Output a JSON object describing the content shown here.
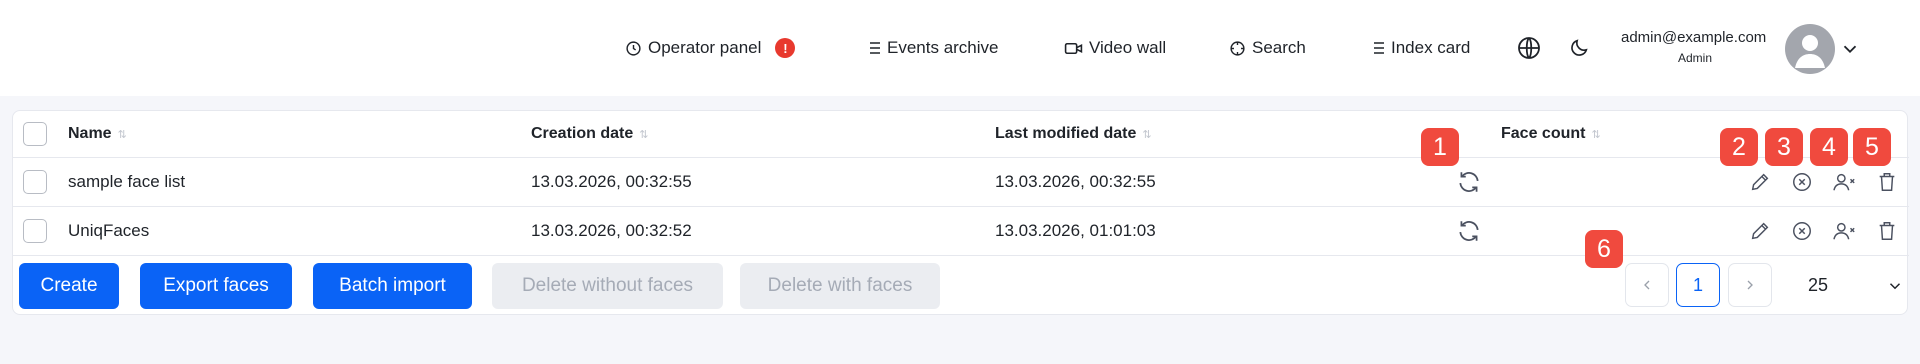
{
  "header": {
    "nav": [
      {
        "label": "Operator panel",
        "icon": "clock-icon",
        "alert": "!"
      },
      {
        "label": "Events archive",
        "icon": "list-icon"
      },
      {
        "label": "Video wall",
        "icon": "video-camera-icon"
      },
      {
        "label": "Search",
        "icon": "crosshair-icon"
      },
      {
        "label": "Index card",
        "icon": "list-icon"
      }
    ],
    "user": {
      "email": "admin@example.com",
      "role": "Admin"
    }
  },
  "table": {
    "columns": [
      "Name",
      "Creation date",
      "Last modified date",
      "Face count"
    ],
    "rows": [
      {
        "name": "sample face list",
        "created": "13.03.2026, 00:32:55",
        "modified": "13.03.2026, 00:32:55",
        "face_count": ""
      },
      {
        "name": "UniqFaces",
        "created": "13.03.2026, 00:32:52",
        "modified": "13.03.2026, 01:01:03",
        "face_count": ""
      }
    ]
  },
  "footer": {
    "create": "Create",
    "export": "Export faces",
    "batch": "Batch import",
    "delete_without": "Delete without faces",
    "delete_with": "Delete with faces",
    "page": "1",
    "page_size": "25"
  },
  "callouts": [
    "1",
    "2",
    "3",
    "4",
    "5",
    "6"
  ],
  "colors": {
    "accent": "#0a63f6",
    "alert": "#e8392e",
    "callout": "#f04a3e"
  }
}
